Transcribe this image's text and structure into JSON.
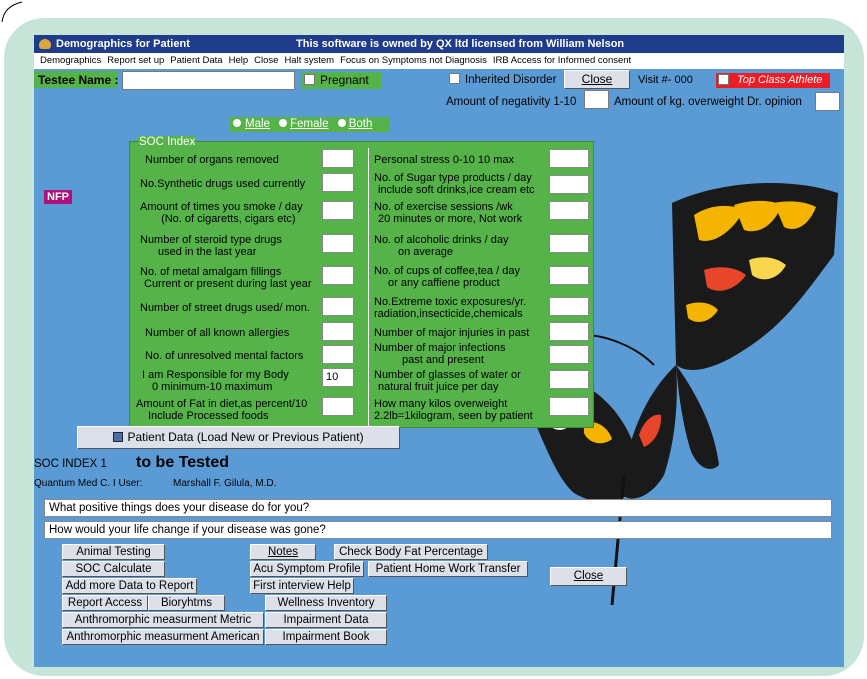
{
  "window": {
    "title": "Demographics for Patient",
    "ownership": "This software is owned by QX ltd licensed from William Nelson"
  },
  "menu": [
    "Demographics",
    "Report set up",
    "Patient Data",
    "Help",
    "Close",
    "Halt system",
    "Focus on Symptoms not Diagnosis",
    "IRB Access for Informed consent"
  ],
  "header": {
    "testee_label": "Testee Name :",
    "testee_value": "",
    "pregnant_label": "Pregnant",
    "inherited_label": "Inherited Disorder",
    "close_label": "Close",
    "visit_label": "Visit #-  000",
    "athlete_label": "Top Class Athlete",
    "negativity_label": "Amount of negativity 1-10",
    "overweight_label": "Amount of kg. overweight Dr. opinion"
  },
  "gender": {
    "male": "Male",
    "female": "Female",
    "both": "Both"
  },
  "nfp_label": "NFP",
  "soc": {
    "legend": "SOC Index",
    "left": [
      {
        "l1": "Number of organs removed",
        "l2": "",
        "value": ""
      },
      {
        "l1": "No.Synthetic drugs used currently",
        "l2": "",
        "value": ""
      },
      {
        "l1": "Amount of times you smoke / day",
        "l2": "(No. of cigaretts, cigars etc)",
        "value": ""
      },
      {
        "l1": "Number of steroid type drugs",
        "l2": "used in the last year",
        "value": ""
      },
      {
        "l1": "No. of metal amalgam fillings",
        "l2": "Current or present during last year",
        "value": ""
      },
      {
        "l1": "Number of street drugs used/ mon.",
        "l2": "",
        "value": ""
      },
      {
        "l1": "Number of all known allergies",
        "l2": "",
        "value": ""
      },
      {
        "l1": "No. of unresolved mental factors",
        "l2": "",
        "value": ""
      },
      {
        "l1": "I am Responsible for my Body",
        "l2": "0 minimum-10 maximum",
        "value": "10"
      },
      {
        "l1": "Amount of Fat in diet,as percent/10",
        "l2": "Include Processed foods",
        "value": ""
      }
    ],
    "right": [
      {
        "l1": "Personal stress 0-10 10 max",
        "l2": "",
        "value": ""
      },
      {
        "l1": "No. of Sugar type products / day",
        "l2": "include soft drinks,ice cream etc",
        "value": ""
      },
      {
        "l1": "No. of exercise sessions /wk",
        "l2": "20 minutes or more, Not work",
        "value": ""
      },
      {
        "l1": "No. of alcoholic drinks / day",
        "l2": "on average",
        "value": ""
      },
      {
        "l1": "No. of cups of coffee,tea / day",
        "l2": "or any caffiene product",
        "value": ""
      },
      {
        "l1": "No.Extreme toxic exposures/yr.",
        "l2": "radiation,insecticide,chemicals",
        "value": ""
      },
      {
        "l1": "Number of major injuries in past",
        "l2": "",
        "value": ""
      },
      {
        "l1": "Number of major infections",
        "l2": "past and present",
        "value": ""
      },
      {
        "l1": "Number of glasses of water or",
        "l2": "natural fruit juice per day",
        "value": ""
      },
      {
        "l1": "How many kilos overweight",
        "l2": "2.2lb=1kilogram, seen by patient",
        "value": ""
      }
    ]
  },
  "patient_data_button": "Patient Data (Load New or Previous Patient)",
  "soc_index_label": "SOC INDEX  1",
  "to_be_tested": "to be Tested",
  "user_label": "Quantum Med C. I User:",
  "user_name": "Marshall F. Gilula, M.D.",
  "questions": {
    "q1": "What positive things does your disease do for you?",
    "q2": "How would your life change if your disease was gone?"
  },
  "buttons": {
    "animal_testing": "Animal Testing",
    "soc_calculate": "SOC Calculate",
    "add_more": "Add more Data to Report",
    "report_access": "Report  Access",
    "bioryhtms": "Bioryhtms",
    "anthro_metric": "Anthromorphic  measurment Metric",
    "anthro_american": "Anthromorphic  measurment American",
    "notes": "Notes",
    "check_body_fat": "Check Body Fat Percentage",
    "acu_symptom": "Acu Symptom Profile",
    "home_work": "Patient Home Work Transfer",
    "first_interview": "First interview Help",
    "wellness": "Wellness Inventory",
    "impairment_data": "Impairment Data",
    "impairment_book": "Impairment Book",
    "close": "Close"
  },
  "colors": {
    "app_bg": "#5b9bd5",
    "titlebar": "#1f3c8a",
    "green_panel": "#55b34a",
    "athlete_red": "#ee1c24",
    "frame": "#c6e4d8",
    "nfp": "#b0107a"
  }
}
